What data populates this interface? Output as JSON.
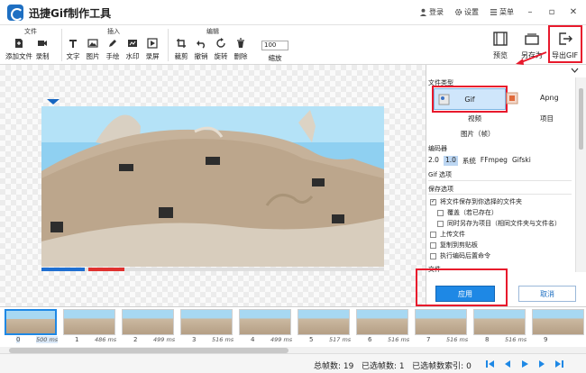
{
  "app": {
    "title": "迅捷Gif制作工具",
    "login": "登录",
    "settings": "设置",
    "menu": "菜单"
  },
  "ribbon": {
    "file_group": "文件",
    "add_file": "添加文件",
    "record": "录制",
    "insert_group": "插入",
    "text": "文字",
    "image": "图片",
    "draw": "手绘",
    "watermark": "水印",
    "screen_record": "录屏",
    "edit_group": "编辑",
    "crop": "裁剪",
    "undo": "撤销",
    "rotate": "旋转",
    "delete": "删除",
    "zoom_value": "100",
    "zoom_label": "缩放",
    "preview": "预览",
    "save_as": "另存为",
    "export_gif": "导出GIF"
  },
  "panel": {
    "section_file_type": "文件类型",
    "type_gif": "Gif",
    "type_apng": "Apng",
    "type_video": "视频",
    "type_project": "项目",
    "type_image_frames": "图片（帧）",
    "section_encoder": "编码器",
    "encoders": [
      "2.0",
      "1.0",
      "系统",
      "FFmpeg",
      "Gifski"
    ],
    "section_gif_options": "Gif 选项",
    "section_save_options": "保存选项",
    "opt_save_folder": "将文件保存到你选择的文件夹",
    "opt_overwrite": "覆盖（若已存在）",
    "opt_save_project": "同时另存为项目（相同文件夹与文件名）",
    "opt_upload": "上传文件",
    "opt_copy_clipboard": "复制到剪贴板",
    "opt_run_command": "执行编码后置命令",
    "section_file": "文件",
    "apply": "应用",
    "cancel": "取消"
  },
  "timeline": {
    "frames": [
      {
        "index": "0",
        "ms": "500 ms"
      },
      {
        "index": "1",
        "ms": "486 ms"
      },
      {
        "index": "2",
        "ms": "499 ms"
      },
      {
        "index": "3",
        "ms": "516 ms"
      },
      {
        "index": "4",
        "ms": "499 ms"
      },
      {
        "index": "5",
        "ms": "517 ms"
      },
      {
        "index": "6",
        "ms": "516 ms"
      },
      {
        "index": "7",
        "ms": "516 ms"
      },
      {
        "index": "8",
        "ms": "516 ms"
      },
      {
        "index": "9",
        "ms": ""
      }
    ]
  },
  "status": {
    "total_frames_label": "总帧数: 19",
    "selected_frames_label": "已选帧数: 1",
    "selected_index_label": "已选帧数索引: 0"
  },
  "colors": {
    "accent": "#1e88e5",
    "highlight": "#e8192c",
    "logo": "#1e6fc2"
  }
}
